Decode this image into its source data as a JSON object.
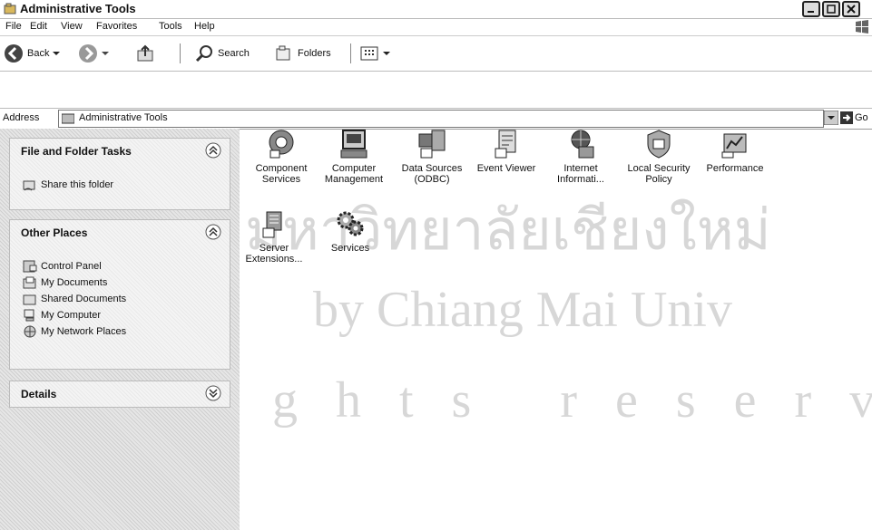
{
  "window": {
    "title": "Administrative Tools"
  },
  "menu": [
    "File",
    "Edit",
    "View",
    "Favorites",
    "Tools",
    "Help"
  ],
  "toolbar": {
    "back": "Back",
    "search": "Search",
    "folders": "Folders"
  },
  "address": {
    "label": "Address",
    "value": "Administrative Tools",
    "go": "Go"
  },
  "tasks": {
    "title": "File and Folder Tasks",
    "items": [
      "Share this folder"
    ]
  },
  "places": {
    "title": "Other Places",
    "items": [
      "Control Panel",
      "My Documents",
      "Shared Documents",
      "My Computer",
      "My Network Places"
    ]
  },
  "details": {
    "title": "Details"
  },
  "icons": [
    {
      "label": "Component Services"
    },
    {
      "label": "Computer Management"
    },
    {
      "label": "Data Sources (ODBC)"
    },
    {
      "label": "Event Viewer"
    },
    {
      "label": "Internet Informati..."
    },
    {
      "label": "Local Security Policy"
    },
    {
      "label": "Performance"
    },
    {
      "label": "Server Extensions..."
    },
    {
      "label": "Services"
    }
  ],
  "watermark": {
    "line1": "มหาวิทยาลัยเชียงใหม่",
    "line2": "by Chiang Mai Univ",
    "line3": "g h t s   r e s e r v"
  }
}
